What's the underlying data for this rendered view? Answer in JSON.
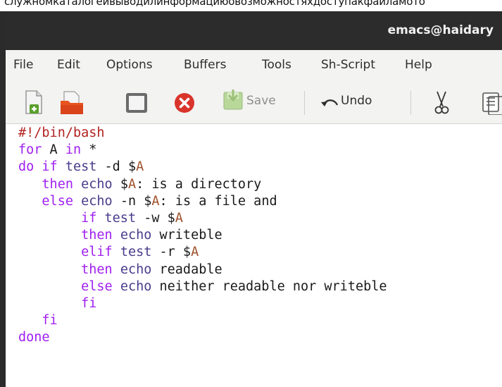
{
  "caption": "служномкаталогеивыводилинформациюовозможностяхдоступакфайламото",
  "window": {
    "title": "emacs@haidary"
  },
  "menu": [
    "File",
    "Edit",
    "Options",
    "Buffers",
    "Tools",
    "Sh-Script",
    "Help"
  ],
  "toolbar": {
    "save_label": "Save",
    "undo_label": "Undo",
    "icons": [
      "new-file-icon",
      "open-folder-icon",
      "dired-icon",
      "close-buffer-icon",
      "save-icon",
      "undo-icon",
      "cut-icon",
      "copy-icon"
    ]
  },
  "colors": {
    "titlebar": "#2c2c2c",
    "menubar": "#f3f3f1",
    "keyword": "#a020f0",
    "builtin": "#483d8b",
    "comment": "#b22222",
    "variable": "#a0522d",
    "close_red": "#d9342b",
    "folder_orange": "#e8531f"
  },
  "code": [
    [
      {
        "t": "#!/bin/bash",
        "c": "cm"
      }
    ],
    [
      {
        "t": "for",
        "c": "kw"
      },
      {
        "t": " A "
      },
      {
        "t": "in",
        "c": "kw"
      },
      {
        "t": " *"
      }
    ],
    [
      {
        "t": "do",
        "c": "kw"
      },
      {
        "t": " "
      },
      {
        "t": "if",
        "c": "kw"
      },
      {
        "t": " "
      },
      {
        "t": "test",
        "c": "bi"
      },
      {
        "t": " -d $"
      },
      {
        "t": "A",
        "c": "vr"
      }
    ],
    [
      {
        "t": "   "
      },
      {
        "t": "then",
        "c": "kw"
      },
      {
        "t": " "
      },
      {
        "t": "echo",
        "c": "bi"
      },
      {
        "t": " $"
      },
      {
        "t": "A",
        "c": "vr"
      },
      {
        "t": ": is a directory"
      }
    ],
    [
      {
        "t": "   "
      },
      {
        "t": "else",
        "c": "kw"
      },
      {
        "t": " "
      },
      {
        "t": "echo",
        "c": "bi"
      },
      {
        "t": " -n $"
      },
      {
        "t": "A",
        "c": "vr"
      },
      {
        "t": ": is a file and"
      }
    ],
    [
      {
        "t": "        "
      },
      {
        "t": "if",
        "c": "kw"
      },
      {
        "t": " "
      },
      {
        "t": "test",
        "c": "bi"
      },
      {
        "t": " -w $"
      },
      {
        "t": "A",
        "c": "vr"
      }
    ],
    [
      {
        "t": "        "
      },
      {
        "t": "then",
        "c": "kw"
      },
      {
        "t": " "
      },
      {
        "t": "echo",
        "c": "bi"
      },
      {
        "t": " writeble"
      }
    ],
    [
      {
        "t": "        "
      },
      {
        "t": "elif",
        "c": "kw"
      },
      {
        "t": " "
      },
      {
        "t": "test",
        "c": "bi"
      },
      {
        "t": " -r $"
      },
      {
        "t": "A",
        "c": "vr"
      }
    ],
    [
      {
        "t": "        "
      },
      {
        "t": "then",
        "c": "kw"
      },
      {
        "t": " "
      },
      {
        "t": "echo",
        "c": "bi"
      },
      {
        "t": " readable"
      }
    ],
    [
      {
        "t": "        "
      },
      {
        "t": "else",
        "c": "kw"
      },
      {
        "t": " "
      },
      {
        "t": "echo",
        "c": "bi"
      },
      {
        "t": " neither readable nor writeble"
      }
    ],
    [
      {
        "t": "        "
      },
      {
        "t": "fi",
        "c": "kw"
      }
    ],
    [
      {
        "t": "   "
      },
      {
        "t": "fi",
        "c": "kw"
      }
    ],
    [
      {
        "t": "done",
        "c": "kw"
      }
    ]
  ]
}
